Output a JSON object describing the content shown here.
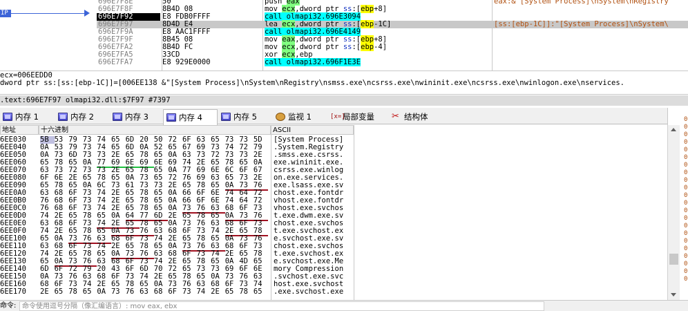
{
  "disasm": {
    "eip_label": "IP",
    "rows": [
      {
        "addr": "696E7F8E",
        "bytes": "50",
        "instr": "push eax",
        "comment": "eax:&\"[System Process]\\nSystem\\nRegistry"
      },
      {
        "addr": "696E7F8F",
        "bytes": "8B4D 08",
        "instr": "mov ecx,dword ptr ss:[ebp+8]",
        "comment": ""
      },
      {
        "addr": "696E7F92",
        "bytes": "E8 FDB0FFFF",
        "instr": "call olmapi32.696E3094",
        "comment": ""
      },
      {
        "addr": "696E7F97",
        "bytes": "8D4D E4",
        "instr": "lea ecx,dword ptr ss:[ebp-1C]",
        "comment": "[ss:[ebp-1C]]:\"[System Process]\\nSystem\\"
      },
      {
        "addr": "696E7F9A",
        "bytes": "E8 AAC1FFFF",
        "instr": "call olmapi32.696E4149",
        "comment": ""
      },
      {
        "addr": "696E7F9F",
        "bytes": "8B45 08",
        "instr": "mov eax,dword ptr ss:[ebp+8]",
        "comment": ""
      },
      {
        "addr": "696E7FA2",
        "bytes": "8B4D FC",
        "instr": "mov ecx,dword ptr ss:[ebp-4]",
        "comment": ""
      },
      {
        "addr": "696E7FA5",
        "bytes": "33CD",
        "instr": "xor ecx,ebp",
        "comment": ""
      },
      {
        "addr": "696E7FA7",
        "bytes": "E8 929E0000",
        "instr": "call olmapi32.696F1E3E",
        "comment": ""
      }
    ]
  },
  "info": {
    "line1": "ecx=006EEDD0",
    "line2": "dword ptr ss:[ss:[ebp-1C]]=[006EE138 &\"[System Process]\\nSystem\\nRegistry\\nsmss.exe\\ncsrss.exe\\nwininit.exe\\ncsrss.exe\\nwinlogon.exe\\nservices.",
    "status": ".text:696E7F97 olmapi32.dll:$7F97 #7397"
  },
  "tabs": [
    {
      "label": "内存 1",
      "icon": "memory-icon"
    },
    {
      "label": "内存 2",
      "icon": "memory-icon"
    },
    {
      "label": "内存 3",
      "icon": "memory-icon"
    },
    {
      "label": "内存 4",
      "icon": "memory-icon"
    },
    {
      "label": "内存 5",
      "icon": "memory-icon"
    },
    {
      "label": "监视 1",
      "icon": "watch-icon"
    },
    {
      "label": "局部变量",
      "icon": "locals-icon",
      "icon_text": "[x=]"
    },
    {
      "label": "结构体",
      "icon": "struct-icon"
    }
  ],
  "dump": {
    "col_addr": "地址",
    "col_hex": "十六进制",
    "col_ascii": "ASCII",
    "rows": [
      {
        "addr": "006EE030",
        "hex": [
          "5B",
          "53",
          "79",
          "73",
          "74",
          "65",
          "6D",
          "20",
          "50",
          "72",
          "6F",
          "63",
          "65",
          "73",
          "73",
          "5D"
        ],
        "ascii": "[System Process]"
      },
      {
        "addr": "006EE040",
        "hex": [
          "0A",
          "53",
          "79",
          "73",
          "74",
          "65",
          "6D",
          "0A",
          "52",
          "65",
          "67",
          "69",
          "73",
          "74",
          "72",
          "79"
        ],
        "ascii": ".System.Registry"
      },
      {
        "addr": "006EE050",
        "hex": [
          "0A",
          "73",
          "6D",
          "73",
          "73",
          "2E",
          "65",
          "78",
          "65",
          "0A",
          "63",
          "73",
          "72",
          "73",
          "73",
          "2E"
        ],
        "ascii": ".smss.exe.csrss."
      },
      {
        "addr": "006EE060",
        "hex": [
          "65",
          "78",
          "65",
          "0A",
          "77",
          "69",
          "6E",
          "69",
          "6E",
          "69",
          "74",
          "2E",
          "65",
          "78",
          "65",
          "0A"
        ],
        "ascii": "exe.wininit.exe."
      },
      {
        "addr": "006EE070",
        "hex": [
          "63",
          "73",
          "72",
          "73",
          "73",
          "2E",
          "65",
          "78",
          "65",
          "0A",
          "77",
          "69",
          "6E",
          "6C",
          "6F",
          "67"
        ],
        "ascii": "csrss.exe.winlog"
      },
      {
        "addr": "006EE080",
        "hex": [
          "6F",
          "6E",
          "2E",
          "65",
          "78",
          "65",
          "0A",
          "73",
          "65",
          "72",
          "76",
          "69",
          "63",
          "65",
          "73",
          "2E"
        ],
        "ascii": "on.exe.services."
      },
      {
        "addr": "006EE090",
        "hex": [
          "65",
          "78",
          "65",
          "0A",
          "6C",
          "73",
          "61",
          "73",
          "73",
          "2E",
          "65",
          "78",
          "65",
          "0A",
          "73",
          "76"
        ],
        "ascii": "exe.lsass.exe.sv"
      },
      {
        "addr": "006EE0A0",
        "hex": [
          "63",
          "68",
          "6F",
          "73",
          "74",
          "2E",
          "65",
          "78",
          "65",
          "0A",
          "66",
          "6F",
          "6E",
          "74",
          "64",
          "72"
        ],
        "ascii": "chost.exe.fontdr"
      },
      {
        "addr": "006EE0B0",
        "hex": [
          "76",
          "68",
          "6F",
          "73",
          "74",
          "2E",
          "65",
          "78",
          "65",
          "0A",
          "66",
          "6F",
          "6E",
          "74",
          "64",
          "72"
        ],
        "ascii": "vhost.exe.fontdr"
      },
      {
        "addr": "006EE0C0",
        "hex": [
          "76",
          "68",
          "6F",
          "73",
          "74",
          "2E",
          "65",
          "78",
          "65",
          "0A",
          "73",
          "76",
          "63",
          "68",
          "6F",
          "73"
        ],
        "ascii": "vhost.exe.svchos"
      },
      {
        "addr": "006EE0D0",
        "hex": [
          "74",
          "2E",
          "65",
          "78",
          "65",
          "0A",
          "64",
          "77",
          "6D",
          "2E",
          "65",
          "78",
          "65",
          "0A",
          "73",
          "76"
        ],
        "ascii": "t.exe.dwm.exe.sv"
      },
      {
        "addr": "006EE0E0",
        "hex": [
          "63",
          "68",
          "6F",
          "73",
          "74",
          "2E",
          "65",
          "78",
          "65",
          "0A",
          "73",
          "76",
          "63",
          "68",
          "6F",
          "73"
        ],
        "ascii": "chost.exe.svchos"
      },
      {
        "addr": "006EE0F0",
        "hex": [
          "74",
          "2E",
          "65",
          "78",
          "65",
          "0A",
          "73",
          "76",
          "63",
          "68",
          "6F",
          "73",
          "74",
          "2E",
          "65",
          "78"
        ],
        "ascii": "t.exe.svchost.ex"
      },
      {
        "addr": "006EE100",
        "hex": [
          "65",
          "0A",
          "73",
          "76",
          "63",
          "68",
          "6F",
          "73",
          "74",
          "2E",
          "65",
          "78",
          "65",
          "0A",
          "73",
          "76"
        ],
        "ascii": "e.svchost.exe.sv"
      },
      {
        "addr": "006EE110",
        "hex": [
          "63",
          "68",
          "6F",
          "73",
          "74",
          "2E",
          "65",
          "78",
          "65",
          "0A",
          "73",
          "76",
          "63",
          "68",
          "6F",
          "73"
        ],
        "ascii": "chost.exe.svchos"
      },
      {
        "addr": "006EE120",
        "hex": [
          "74",
          "2E",
          "65",
          "78",
          "65",
          "0A",
          "73",
          "76",
          "63",
          "68",
          "6F",
          "73",
          "74",
          "2E",
          "65",
          "78"
        ],
        "ascii": "t.exe.svchost.ex"
      },
      {
        "addr": "006EE130",
        "hex": [
          "65",
          "0A",
          "73",
          "76",
          "63",
          "68",
          "6F",
          "73",
          "74",
          "2E",
          "65",
          "78",
          "65",
          "0A",
          "4D",
          "65"
        ],
        "ascii": "e.svchost.exe.Me"
      },
      {
        "addr": "006EE140",
        "hex": [
          "6D",
          "6F",
          "72",
          "79",
          "20",
          "43",
          "6F",
          "6D",
          "70",
          "72",
          "65",
          "73",
          "73",
          "69",
          "6F",
          "6E"
        ],
        "ascii": "mory Compression"
      },
      {
        "addr": "006EE150",
        "hex": [
          "0A",
          "73",
          "76",
          "63",
          "68",
          "6F",
          "73",
          "74",
          "2E",
          "65",
          "78",
          "65",
          "0A",
          "73",
          "76",
          "63"
        ],
        "ascii": ".svchost.exe.svc"
      },
      {
        "addr": "006EE160",
        "hex": [
          "68",
          "6F",
          "73",
          "74",
          "2E",
          "65",
          "78",
          "65",
          "0A",
          "73",
          "76",
          "63",
          "68",
          "6F",
          "73",
          "74"
        ],
        "ascii": "host.exe.svchost"
      },
      {
        "addr": "006EE170",
        "hex": [
          "2E",
          "65",
          "78",
          "65",
          "0A",
          "73",
          "76",
          "63",
          "68",
          "6F",
          "73",
          "74",
          "2E",
          "65",
          "78",
          "65"
        ],
        "ascii": ".exe.svchost.exe"
      }
    ],
    "red_underlines": [
      [
        6,
        13,
        15
      ],
      [
        9,
        10,
        12
      ],
      [
        10,
        13,
        15
      ],
      [
        10,
        6,
        8
      ],
      [
        11,
        4,
        6
      ],
      [
        12,
        5,
        7
      ],
      [
        12,
        13,
        15
      ],
      [
        13,
        2,
        4
      ],
      [
        14,
        10,
        12
      ],
      [
        15,
        5,
        7
      ],
      [
        16,
        1,
        3
      ]
    ],
    "green_underlines": [
      [
        3,
        4,
        7
      ]
    ],
    "right_strip_digits": [
      "0",
      "0",
      "0",
      "0",
      "0",
      "0",
      "0",
      "0",
      "0",
      "0",
      "0",
      "0",
      "0",
      "0",
      "0",
      "0",
      "0",
      "0",
      "0",
      "0",
      "0",
      "0"
    ]
  },
  "cmd": {
    "label": "命令:",
    "placeholder": "命令使用逗号分隔（像汇编语言）: mov eax, ebx"
  }
}
